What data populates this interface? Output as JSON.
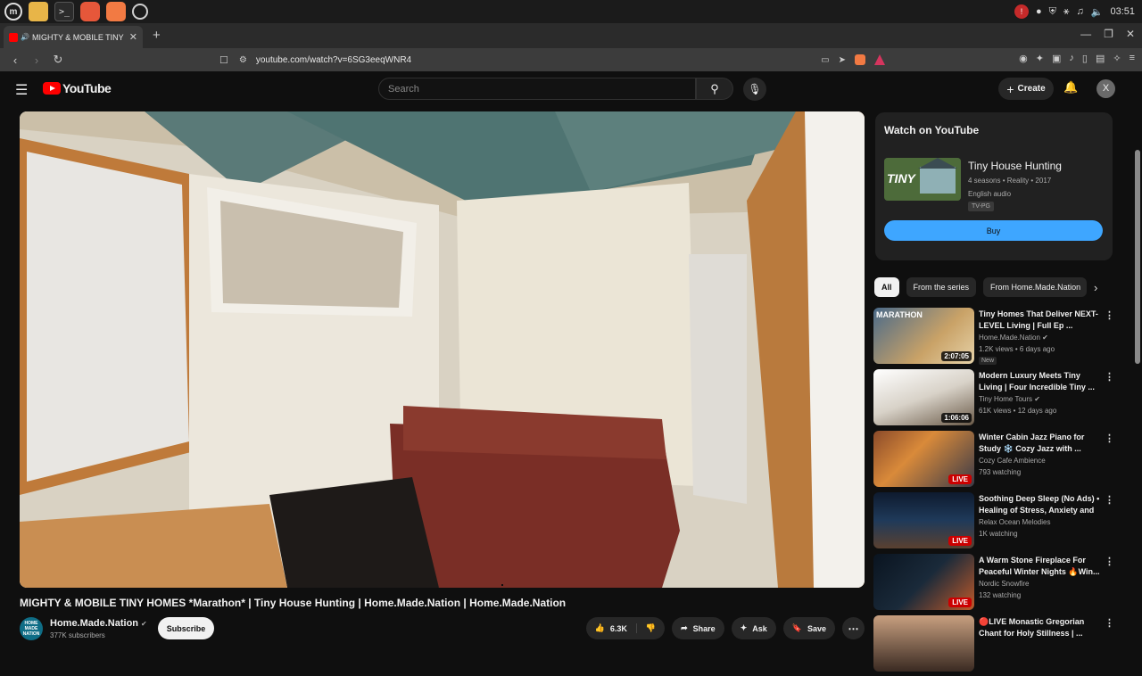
{
  "taskbar": {
    "apps": [
      "mint-menu-icon",
      "files-icon",
      "terminal-icon",
      "firefox-icon",
      "brave-icon",
      "chrome-icon"
    ],
    "clock": "03:51"
  },
  "browser": {
    "tab_title": "MIGHTY & MOBILE TINY HO",
    "url": "youtube.com/watch?v=6SG3eeqWNR4"
  },
  "youtube": {
    "logo_text": "YouTube",
    "search_placeholder": "Search",
    "create_label": "Create",
    "avatar_letter": "X"
  },
  "video": {
    "title": "MIGHTY & MOBILE TINY HOMES *Marathon* | Tiny House Hunting | Home.Made.Nation | Home.Made.Nation",
    "channel": "Home.Made.Nation",
    "channel_avatar_text": "HOME MADE NATION",
    "subscribers": "377K subscribers",
    "subscribe_label": "Subscribe",
    "likes": "6.3K",
    "share_label": "Share",
    "ask_label": "Ask",
    "save_label": "Save"
  },
  "watch_card": {
    "heading": "Watch on YouTube",
    "show_title": "Tiny House Hunting",
    "show_meta": "4 seasons • Reality • 2017",
    "audio": "English audio",
    "rating": "TV-PG",
    "buy_label": "Buy",
    "thumb_text": "TINY"
  },
  "chips": [
    "All",
    "From the series",
    "From Home.Made.Nation"
  ],
  "recommendations": [
    {
      "title": "Tiny Homes That Deliver NEXT-LEVEL Living | Full Ep ...",
      "channel": "Home.Made.Nation",
      "verified": true,
      "meta": "1.2K views • 6 days ago",
      "badge": "New",
      "duration": "2:07:05",
      "live": false,
      "thumb_text": "MARATHON"
    },
    {
      "title": "Modern Luxury Meets Tiny Living | Four Incredible Tiny ...",
      "channel": "Tiny Home Tours",
      "verified": true,
      "meta": "61K views • 12 days ago",
      "badge": "",
      "duration": "1:06:06",
      "live": false,
      "thumb_text": ""
    },
    {
      "title": "Winter Cabin Jazz Piano for Study ❄️ Cozy Jazz with ...",
      "channel": "Cozy Cafe Ambience",
      "verified": false,
      "meta": "793 watching",
      "badge": "",
      "duration": "",
      "live": true,
      "thumb_text": ""
    },
    {
      "title": "Soothing Deep Sleep (No Ads) • Healing of Stress, Anxiety and ...",
      "channel": "Relax Ocean Melodies",
      "verified": false,
      "meta": "1K watching",
      "badge": "",
      "duration": "",
      "live": true,
      "thumb_text": ""
    },
    {
      "title": "A Warm Stone Fireplace For Peaceful Winter Nights 🔥Win...",
      "channel": "Nordic Snowfire",
      "verified": false,
      "meta": "132 watching",
      "badge": "",
      "duration": "",
      "live": true,
      "thumb_text": ""
    },
    {
      "title": "🔴LIVE Monastic Gregorian Chant for Holy Stillness | ...",
      "channel": "",
      "verified": false,
      "meta": "",
      "badge": "",
      "duration": "",
      "live": false,
      "thumb_text": ""
    }
  ],
  "live_label": "LIVE"
}
